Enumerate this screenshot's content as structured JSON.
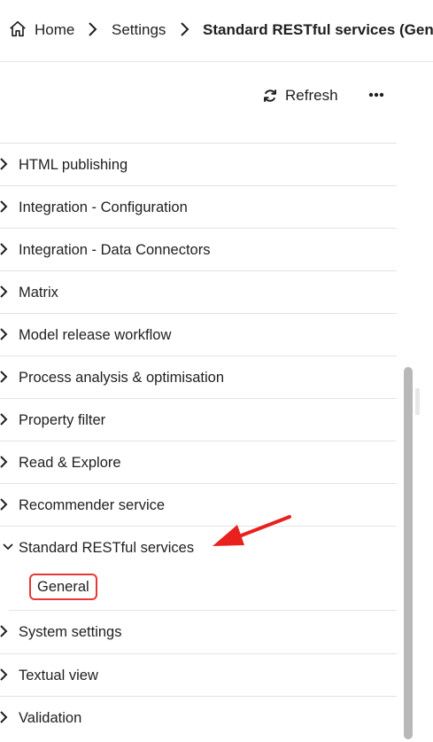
{
  "breadcrumb": {
    "home_label": "Home",
    "settings_label": "Settings",
    "current_label": "Standard RESTful services (General)"
  },
  "toolbar": {
    "refresh_label": "Refresh",
    "more_icon": "ellipsis-icon",
    "refresh_icon": "refresh-icon"
  },
  "settings_list": {
    "items": [
      {
        "label": "HTML publishing"
      },
      {
        "label": "Integration - Configuration"
      },
      {
        "label": "Integration - Data Connectors"
      },
      {
        "label": "Matrix"
      },
      {
        "label": "Model release workflow"
      },
      {
        "label": "Process analysis & optimisation"
      },
      {
        "label": "Property filter"
      },
      {
        "label": "Read & Explore"
      },
      {
        "label": "Recommender service"
      },
      {
        "label": "Standard RESTful services",
        "expanded": true,
        "children": [
          {
            "label": "General",
            "selected": true
          }
        ]
      },
      {
        "label": "System settings"
      },
      {
        "label": "Textual view"
      },
      {
        "label": "Validation"
      }
    ]
  },
  "colors": {
    "highlight": "#e53935",
    "arrow": "#e8211f",
    "divider": "#e3e3e3",
    "scrollbar": "#b8b8b8"
  }
}
